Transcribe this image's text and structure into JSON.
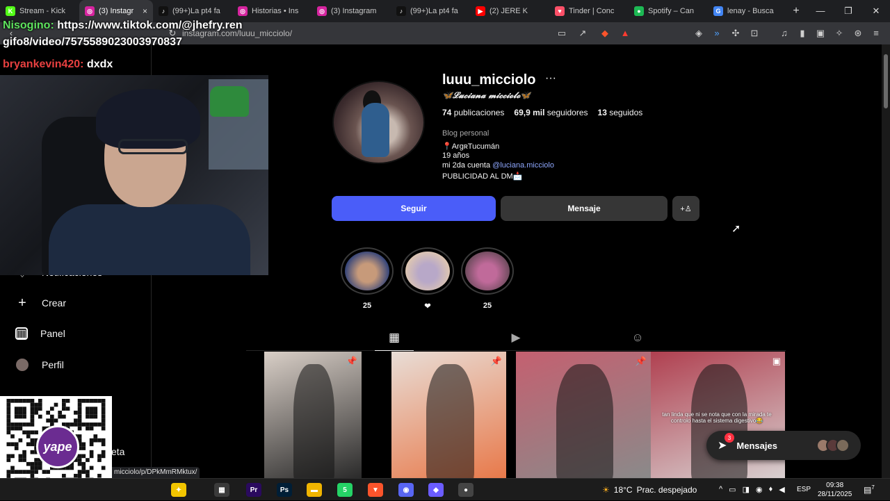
{
  "browser": {
    "tabs": [
      {
        "title": "Stream - Kick",
        "fav": "K",
        "color": "#53fc18"
      },
      {
        "title": "(3) Instagr",
        "fav": "◎",
        "color": "#d6249f",
        "active": true
      },
      {
        "title": "(99+)La pt4 fa",
        "fav": "♪",
        "color": "#111111"
      },
      {
        "title": "Historias • Ins",
        "fav": "◎",
        "color": "#d6249f"
      },
      {
        "title": "(3) Instagram",
        "fav": "◎",
        "color": "#d6249f"
      },
      {
        "title": "(99+)La pt4 fa",
        "fav": "♪",
        "color": "#111111"
      },
      {
        "title": "(2) JERE K",
        "fav": "▶",
        "color": "#ff0000"
      },
      {
        "title": "Tinder | Conc",
        "fav": "♥",
        "color": "#fd5068"
      },
      {
        "title": "Spotify – Can",
        "fav": "●",
        "color": "#1db954"
      },
      {
        "title": "lenay - Busca",
        "fav": "G",
        "color": "#4285f4"
      }
    ],
    "close_glyph": "×",
    "new_tab_glyph": "+",
    "url": "instagram.com/luuu_micciolo/"
  },
  "sidebar": {
    "items": [
      {
        "label": "Notificaciones",
        "icon": "heart-icon"
      },
      {
        "label": "Crear",
        "icon": "plus-icon"
      },
      {
        "label": "Panel",
        "icon": "chart-icon"
      },
      {
        "label": "Perfil",
        "icon": "avatar-icon"
      },
      {
        "label": "eta",
        "icon": ""
      }
    ]
  },
  "profile": {
    "username": "luuu_micciolo",
    "more_glyph": "···",
    "full_name": "🦋𝓛𝓾𝓬𝓲𝓪𝓷𝓪 𝓶𝓲𝓬𝓬𝓲𝓸𝓵𝓸🦋",
    "posts_count": "74",
    "posts_label": "publicaciones",
    "followers_count": "69,9 mil",
    "followers_label": "seguidores",
    "following_count": "13",
    "following_label": "seguidos",
    "category": "Blog personal",
    "bio_lines": [
      "📍ArgʀTucumán",
      "19 años"
    ],
    "bio_link_prefix": "mi 2da cuenta ",
    "bio_link": "@luciana.micciolo",
    "bio_last": "PUBLICIDAD AL DM📩",
    "follow_label": "Seguir",
    "message_label": "Mensaje",
    "add_glyph": "+♙"
  },
  "highlights": [
    {
      "label": "25",
      "colors": [
        "#c79a7a",
        "#2b3f7a"
      ]
    },
    {
      "label": "❤",
      "colors": [
        "#b8a8c8",
        "#e0c8b0"
      ]
    },
    {
      "label": "25",
      "colors": [
        "#c06a9a",
        "#6a4a5a"
      ]
    }
  ],
  "posts": [
    {
      "pinned": true,
      "colors": [
        "#d9cfc7",
        "#2a2a2a"
      ],
      "caption": ""
    },
    {
      "pinned": true,
      "colors": [
        "#e8ddd6",
        "#e8794a"
      ],
      "caption": ""
    },
    {
      "pinned": true,
      "colors": [
        "#c46070",
        "#8a8a8a"
      ],
      "caption": ""
    },
    {
      "pinned": false,
      "colors": [
        "#b04050",
        "#d8d0d0"
      ],
      "caption": "tan linda que ni se nota que con la mirada te controlo hasta el sistema digestivo😂"
    }
  ],
  "messages_pill": {
    "label": "Mensajes",
    "badge": "3"
  },
  "status_url": "micciolo/p/DPkMmRMktux/",
  "overlay": {
    "chat": [
      {
        "nick": "Nisogino:",
        "text": " https://www.tiktok.com/@jhefry.ren",
        "color": "green"
      },
      {
        "nick": "",
        "text": "gifo8/video/7575589023003970837",
        "color": "none"
      },
      {
        "nick": "bryankevin420:",
        "text": " dxdx",
        "color": "red"
      }
    ],
    "yape_label": "yape"
  },
  "taskbar": {
    "apps": [
      {
        "glyph": "✦",
        "color": "#f2c500",
        "name": "copilot-icon"
      },
      {
        "glyph": "▦",
        "color": "#3a3a3a",
        "name": "task-view-icon"
      },
      {
        "glyph": "Pr",
        "color": "#2a0a5e",
        "name": "premiere-icon"
      },
      {
        "glyph": "Ps",
        "color": "#001e36",
        "name": "photoshop-icon"
      },
      {
        "glyph": "▬",
        "color": "#f0b400",
        "name": "explorer-icon"
      },
      {
        "glyph": "5",
        "color": "#25d366",
        "name": "whatsapp-icon"
      },
      {
        "glyph": "▼",
        "color": "#fb542b",
        "name": "brave-icon"
      },
      {
        "glyph": "◉",
        "color": "#5865f2",
        "name": "discord-icon"
      },
      {
        "glyph": "◆",
        "color": "#6b5cff",
        "name": "app-icon"
      },
      {
        "glyph": "●",
        "color": "#444444",
        "name": "obs-icon"
      }
    ],
    "temperature": "18°C",
    "weather_text": "Prac. despejado",
    "language": "ESP",
    "time": "09:38",
    "date": "28/11/2025",
    "notif_count": "7"
  }
}
